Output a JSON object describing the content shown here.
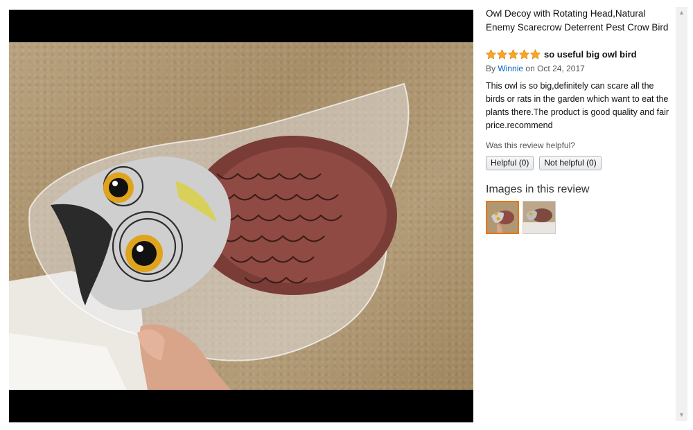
{
  "product": {
    "title": "Owl Decoy with Rotating Head,Natural Enemy Scarecrow Deterrent Pest Crow Bird"
  },
  "review": {
    "rating": 5,
    "max_rating": 5,
    "title": "so useful big owl bird",
    "by_prefix": "By",
    "author": "Winnie",
    "date_text": "on Oct 24, 2017",
    "body": "This owl is so big,definitely can scare all the birds or rats in the garden which want to eat the plants there.The product is good quality and fair price.recommend",
    "helpful_question": "Was this review helpful?",
    "helpful_label": "Helpful (0)",
    "not_helpful_label": "Not helpful (0)"
  },
  "images_section": {
    "heading": "Images in this review",
    "thumbnails": [
      {
        "selected": true
      },
      {
        "selected": false
      }
    ]
  },
  "colors": {
    "star": "#ffa41c",
    "link": "#0066c0",
    "selected_thumb_border": "#e77600"
  },
  "icons": {
    "star": "star-icon",
    "scroll_up": "chevron-up-icon",
    "scroll_down": "chevron-down-icon"
  }
}
